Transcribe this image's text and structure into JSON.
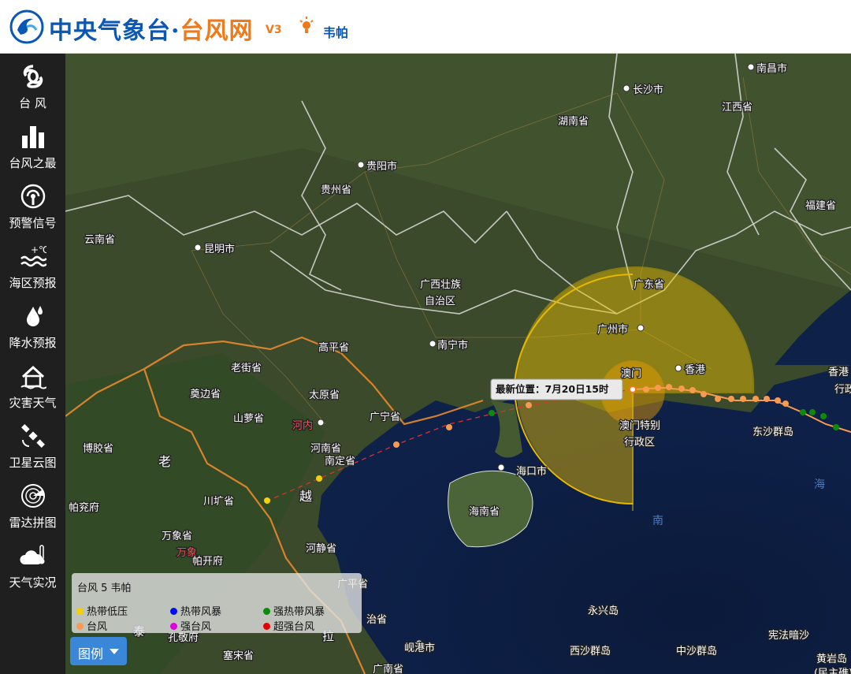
{
  "header": {
    "title_main": "中央气象台·",
    "title_accent": "台风网",
    "version": "V3",
    "typhoon_name": "韦帕"
  },
  "sidebar": {
    "items": [
      {
        "label": "台 风",
        "icon": "typhoon-icon"
      },
      {
        "label": "台风之最",
        "icon": "bar-chart-icon"
      },
      {
        "label": "预警信号",
        "icon": "warning-signal-icon"
      },
      {
        "label": "海区预报",
        "icon": "sea-temperature-icon"
      },
      {
        "label": "降水预报",
        "icon": "raindrop-icon"
      },
      {
        "label": "灾害天气",
        "icon": "house-icon"
      },
      {
        "label": "卫星云图",
        "icon": "satellite-icon"
      },
      {
        "label": "雷达拼图",
        "icon": "radar-icon"
      },
      {
        "label": "天气实况",
        "icon": "cloud-thermometer-icon"
      }
    ]
  },
  "map": {
    "latest_position": "最新位置：7月20日15时",
    "labels": {
      "nanchang": "南昌市",
      "changsha": "长沙市",
      "hunan": "湖南省",
      "jiangxi": "江西省",
      "guiyang": "贵阳市",
      "guizhou": "贵州省",
      "fujian": "福建省",
      "yunnan": "云南省",
      "kunming": "昆明市",
      "guangxi1": "广西壮族",
      "guangxi2": "自治区",
      "guangdong": "广东省",
      "guangzhou": "广州市",
      "nanning": "南宁市",
      "macau": "澳门",
      "hongkong": "香港",
      "hk_right1": "香港",
      "hk_right2": "行政",
      "macau_sar1": "澳门特别",
      "macau_sar2": "行政区",
      "dongsha": "东沙群岛",
      "gaoping": "高平省",
      "laojie": "老街省",
      "taiyuan": "太原省",
      "dianbian": "奠边省",
      "shanluo": "山萝省",
      "hanoi": "河内",
      "henan": "河南省",
      "nanding": "南定省",
      "guangning": "广宁省",
      "boqiao": "博胶省",
      "lao": "老",
      "yue": "越",
      "pafang": "帕兖府",
      "chuankuang": "川圹省",
      "wanxiang_prov": "万象省",
      "wanxiang": "万象",
      "pakesheng": "帕开府",
      "hejing": "河静省",
      "guangping": "广平省",
      "zhiding": "治省",
      "la": "拉",
      "tai": "泰",
      "kaluohua": "孔敬府",
      "saiyuan": "塞宋省",
      "xiangu": "岘港市",
      "guangnan": "广南省",
      "haikou": "海口市",
      "hainan": "海南省",
      "yongxing": "永兴岛",
      "xisha": "西沙群岛",
      "zhongsha": "中沙群岛",
      "xianfa": "宪法暗沙",
      "huangyan1": "黄岩岛",
      "huangyan2": "(民主礁)",
      "nan": "南",
      "hai": "海"
    }
  },
  "legend": {
    "title": "台风   5 韦帕",
    "items": [
      {
        "label": "热带低压",
        "color": "#f5d100"
      },
      {
        "label": "热带风暴",
        "color": "#0010e8"
      },
      {
        "label": "强热带风暴",
        "color": "#0b8a0b"
      },
      {
        "label": "台风",
        "color": "#f89a50"
      },
      {
        "label": "强台风",
        "color": "#e000e0"
      },
      {
        "label": "超强台风",
        "color": "#e80000"
      }
    ],
    "button_label": "图例"
  },
  "colors": {
    "brand_blue": "#0a57b5",
    "brand_orange": "#f07a1a",
    "wind_circle": "#f2b800",
    "track": "#f89a50"
  }
}
